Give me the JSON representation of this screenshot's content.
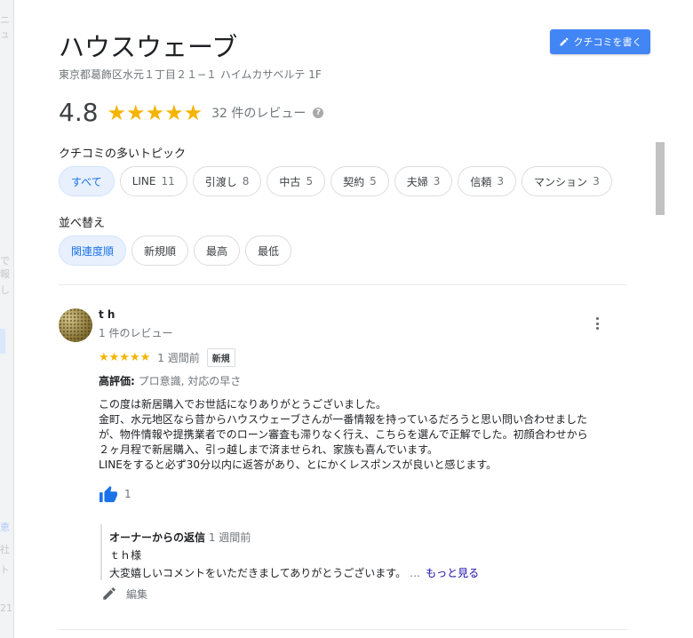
{
  "place": {
    "name": "ハウスウェーブ",
    "address": "東京都葛飾区水元１丁目２１−１ ハイムカサベルテ 1F",
    "write_review_label": "クチコミを書く",
    "rating": "4.8",
    "rating_value": 4.8,
    "review_count_label": "32 件のレビュー"
  },
  "topics": {
    "label": "クチコミの多いトピック",
    "items": [
      {
        "label": "すべて",
        "count": "",
        "active": true
      },
      {
        "label": "LINE",
        "count": "11"
      },
      {
        "label": "引渡し",
        "count": "8"
      },
      {
        "label": "中古",
        "count": "5"
      },
      {
        "label": "契約",
        "count": "5"
      },
      {
        "label": "夫婦",
        "count": "3"
      },
      {
        "label": "信頼",
        "count": "3"
      },
      {
        "label": "マンション",
        "count": "3"
      }
    ]
  },
  "sort": {
    "label": "並べ替え",
    "items": [
      {
        "label": "関連度順",
        "active": true
      },
      {
        "label": "新規順"
      },
      {
        "label": "最高"
      },
      {
        "label": "最低"
      }
    ]
  },
  "review": {
    "reviewer_name": "t h",
    "reviewer_meta": "1 件のレビュー",
    "rating": 5,
    "time": "1 週間前",
    "badge": "新規",
    "highlights_label": "高評価:",
    "highlights_value": "プロ意識, 対応の早さ",
    "body_lines": [
      "この度は新居購入でお世話になりありがとうございました。",
      "金町、水元地区なら昔からハウスウェーブさんが一番情報を持っているだろうと思い問い合わせました",
      "が、物件情報や提携業者でのローン審査も滞りなく行え、こちらを選んで正解でした。初顔合わせから",
      "２ヶ月程で新居購入、引っ越しまで済ませられ、家族も喜んでいます。",
      "LINEをすると必ず30分以内に返答があり、とにかくレスポンスが良いと感じます。"
    ],
    "like_count": "1",
    "owner_reply": {
      "label": "オーナーからの返信",
      "time": "1 週間前",
      "line1": "ｔｈ様",
      "line2": "大変嬉しいコメントをいただきましてありがとうございます。",
      "ellipsis": "…",
      "more_label": "もっと見る"
    },
    "edit_label": "編集"
  },
  "colors": {
    "accent": "#4285f4",
    "star": "#f4b400",
    "chip_active_bg": "#e8f0fe",
    "link": "#1a0dab"
  }
}
